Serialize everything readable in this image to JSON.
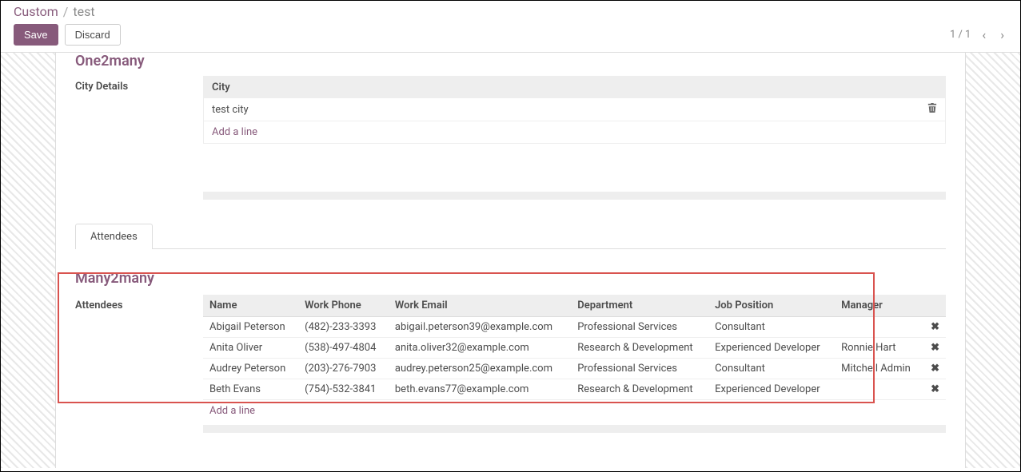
{
  "breadcrumb": {
    "module": "Custom",
    "sep": "/",
    "current": "test"
  },
  "buttons": {
    "save": "Save",
    "discard": "Discard"
  },
  "pager": {
    "text": "1 / 1"
  },
  "one2many": {
    "title": "One2many",
    "field_label": "City Details",
    "header": "City",
    "rows": [
      "test city"
    ],
    "add_line": "Add a line"
  },
  "tabs": {
    "attendees": "Attendees"
  },
  "many2many": {
    "title": "Many2many",
    "field_label": "Attendees",
    "headers": {
      "name": "Name",
      "phone": "Work Phone",
      "email": "Work Email",
      "dept": "Department",
      "job": "Job Position",
      "mgr": "Manager"
    },
    "rows": [
      {
        "name": "Abigail Peterson",
        "phone": "(482)-233-3393",
        "email": "abigail.peterson39@example.com",
        "dept": "Professional Services",
        "job": "Consultant",
        "mgr": ""
      },
      {
        "name": "Anita Oliver",
        "phone": "(538)-497-4804",
        "email": "anita.oliver32@example.com",
        "dept": "Research & Development",
        "job": "Experienced Developer",
        "mgr": "Ronnie Hart"
      },
      {
        "name": "Audrey Peterson",
        "phone": "(203)-276-7903",
        "email": "audrey.peterson25@example.com",
        "dept": "Professional Services",
        "job": "Consultant",
        "mgr": "Mitchell Admin"
      },
      {
        "name": "Beth Evans",
        "phone": "(754)-532-3841",
        "email": "beth.evans77@example.com",
        "dept": "Research & Development",
        "job": "Experienced Developer",
        "mgr": ""
      }
    ],
    "add_line": "Add a line"
  }
}
